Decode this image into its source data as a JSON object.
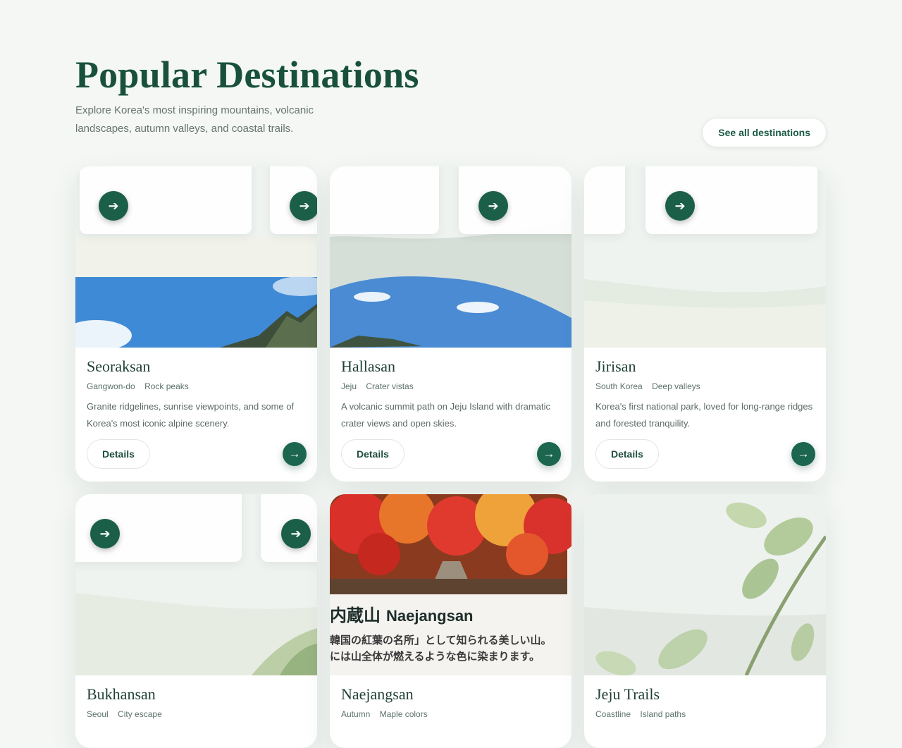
{
  "header": {
    "title": "Popular Destinations",
    "subtitle": "Explore Korea's most inspiring mountains, volcanic landscapes, autumn valleys, and coastal trails.",
    "see_all_label": "See all destinations"
  },
  "cards": [
    {
      "title": "Seoraksan",
      "tags": [
        "Gangwon-do",
        "Rock peaks"
      ],
      "description": "Granite ridgelines, sunrise viewpoints, and some of Korea's most iconic alpine scenery.",
      "details_label": "Details",
      "arrow": "→"
    },
    {
      "title": "Hallasan",
      "tags": [
        "Jeju",
        "Crater vistas"
      ],
      "description": "A volcanic summit path on Jeju Island with dramatic crater views and open skies.",
      "details_label": "Details",
      "arrow": "→"
    },
    {
      "title": "Jirisan",
      "tags": [
        "South Korea",
        "Deep valleys"
      ],
      "description": "Korea's first national park, loved for long-range ridges and forested tranquility.",
      "details_label": "Details",
      "arrow": "→"
    },
    {
      "title": "Bukhansan",
      "tags": [
        "Seoul",
        "City escape"
      ]
    },
    {
      "title": "Naejangsan",
      "tags": [
        "Autumn",
        "Maple colors"
      ],
      "poster": {
        "title_ja": "内蔵山",
        "title_en": "Naejangsan",
        "line1": "韓国の紅葉の名所」として知られる美しい山。",
        "line2": "には山全体が燃えるような色に染まります。"
      }
    },
    {
      "title": "Jeju Trails",
      "tags": [
        "Coastline",
        "Island paths"
      ]
    }
  ],
  "icons": {
    "arrow": "arrow-right-icon"
  },
  "colors": {
    "accent": "#1c6650",
    "title": "#18503c",
    "background": "#f4f7f4"
  }
}
